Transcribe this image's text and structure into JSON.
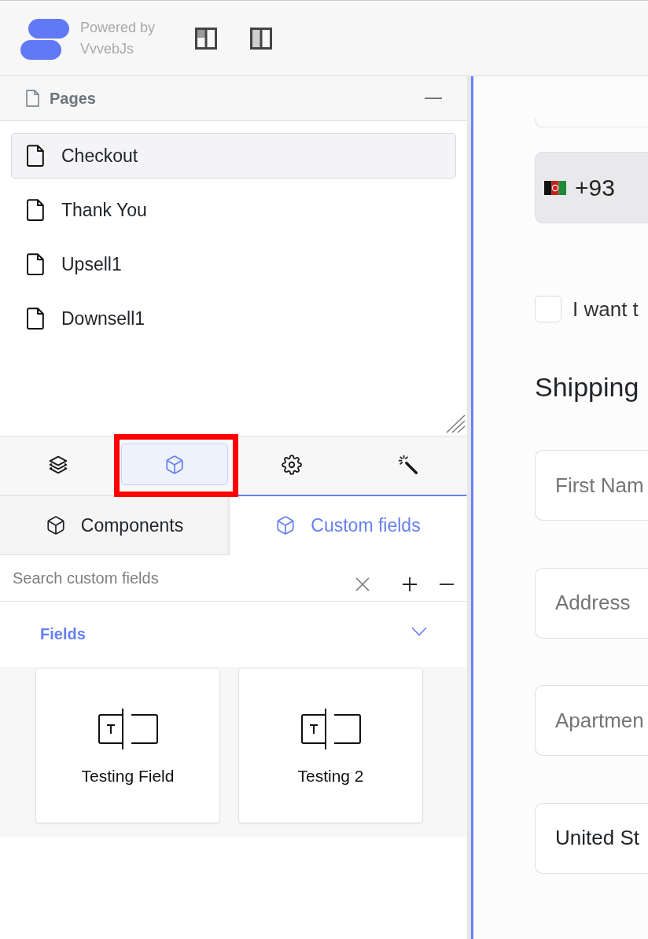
{
  "header": {
    "brand": "Powered by VvvebJs"
  },
  "pages_panel": {
    "title": "Pages",
    "pages": [
      {
        "name": "Checkout",
        "selected": true
      },
      {
        "name": "Thank You",
        "selected": false
      },
      {
        "name": "Upsell1",
        "selected": false
      },
      {
        "name": "Downsell1",
        "selected": false
      }
    ]
  },
  "tool_tabs": [
    {
      "kind": "layers",
      "selected": false,
      "highlighted": false
    },
    {
      "kind": "components",
      "selected": true,
      "highlighted": true
    },
    {
      "kind": "settings",
      "selected": false,
      "highlighted": false
    },
    {
      "kind": "magic",
      "selected": false,
      "highlighted": false
    }
  ],
  "sub_tabs": [
    {
      "label": "Components",
      "selected": false
    },
    {
      "label": "Custom fields",
      "selected": true
    }
  ],
  "search": {
    "placeholder": "Search custom fields"
  },
  "section": {
    "title": "Fields",
    "expanded": true,
    "items": [
      {
        "label": "Testing Field"
      },
      {
        "label": "Testing 2"
      }
    ]
  },
  "canvas": {
    "phone_code": "+93",
    "checkbox": {
      "label": "I want t",
      "checked": false
    },
    "heading": "Shipping",
    "fields": [
      {
        "placeholder": "First Nam"
      },
      {
        "placeholder": "Address"
      },
      {
        "placeholder": "Apartmen"
      },
      {
        "value": "United St"
      }
    ]
  }
}
